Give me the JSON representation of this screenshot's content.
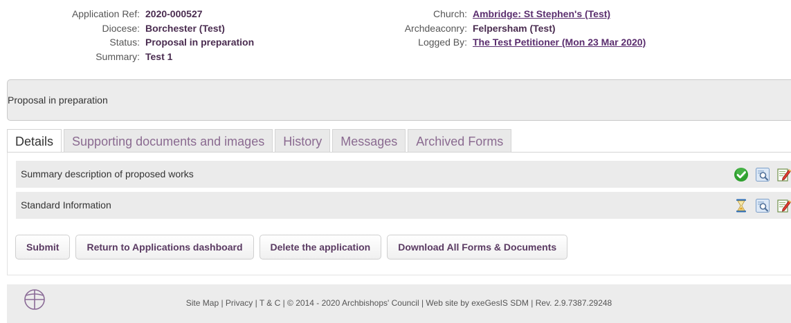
{
  "application": {
    "left": [
      {
        "label": "Application Ref:",
        "value": "2020-000527"
      },
      {
        "label": "Diocese:",
        "value": "Borchester (Test)"
      },
      {
        "label": "Status:",
        "value": "Proposal in preparation"
      },
      {
        "label": "Summary:",
        "value": "Test 1"
      }
    ],
    "right": [
      {
        "label": "Church:",
        "value": "Ambridge: St Stephen's (Test)"
      },
      {
        "label": "Archdeaconry:",
        "value": "Felpersham (Test)"
      },
      {
        "label": "Logged By:",
        "value": "The Test Petitioner (Mon 23 Mar 2020)"
      }
    ]
  },
  "status_box": {
    "text": "Proposal in preparation"
  },
  "tabs": [
    {
      "label": "Details",
      "active": true
    },
    {
      "label": "Supporting documents and images"
    },
    {
      "label": "History"
    },
    {
      "label": "Messages"
    },
    {
      "label": "Archived Forms"
    }
  ],
  "forms": [
    {
      "name": "Summary description of proposed works",
      "status_icon": "green-check-icon"
    },
    {
      "name": "Standard Information",
      "status_icon": "hourglass-icon"
    }
  ],
  "buttons": {
    "submit": "Submit",
    "return": "Return to Applications dashboard",
    "delete": "Delete the application",
    "download": "Download All Forms & Documents"
  },
  "footer": {
    "logo_icon": "church-of-england-logo",
    "text": "Site Map | Privacy | T & C | © 2014 - 2020 Archbishops' Council | Web site by exeGesIS SDM | Rev. 2.9.7387.29248"
  },
  "colors": {
    "link": "#5a2d6e",
    "tab_inactive_text": "#8a6a90",
    "status_green": "#2fa02f",
    "panel_grey": "#ebebeb"
  }
}
